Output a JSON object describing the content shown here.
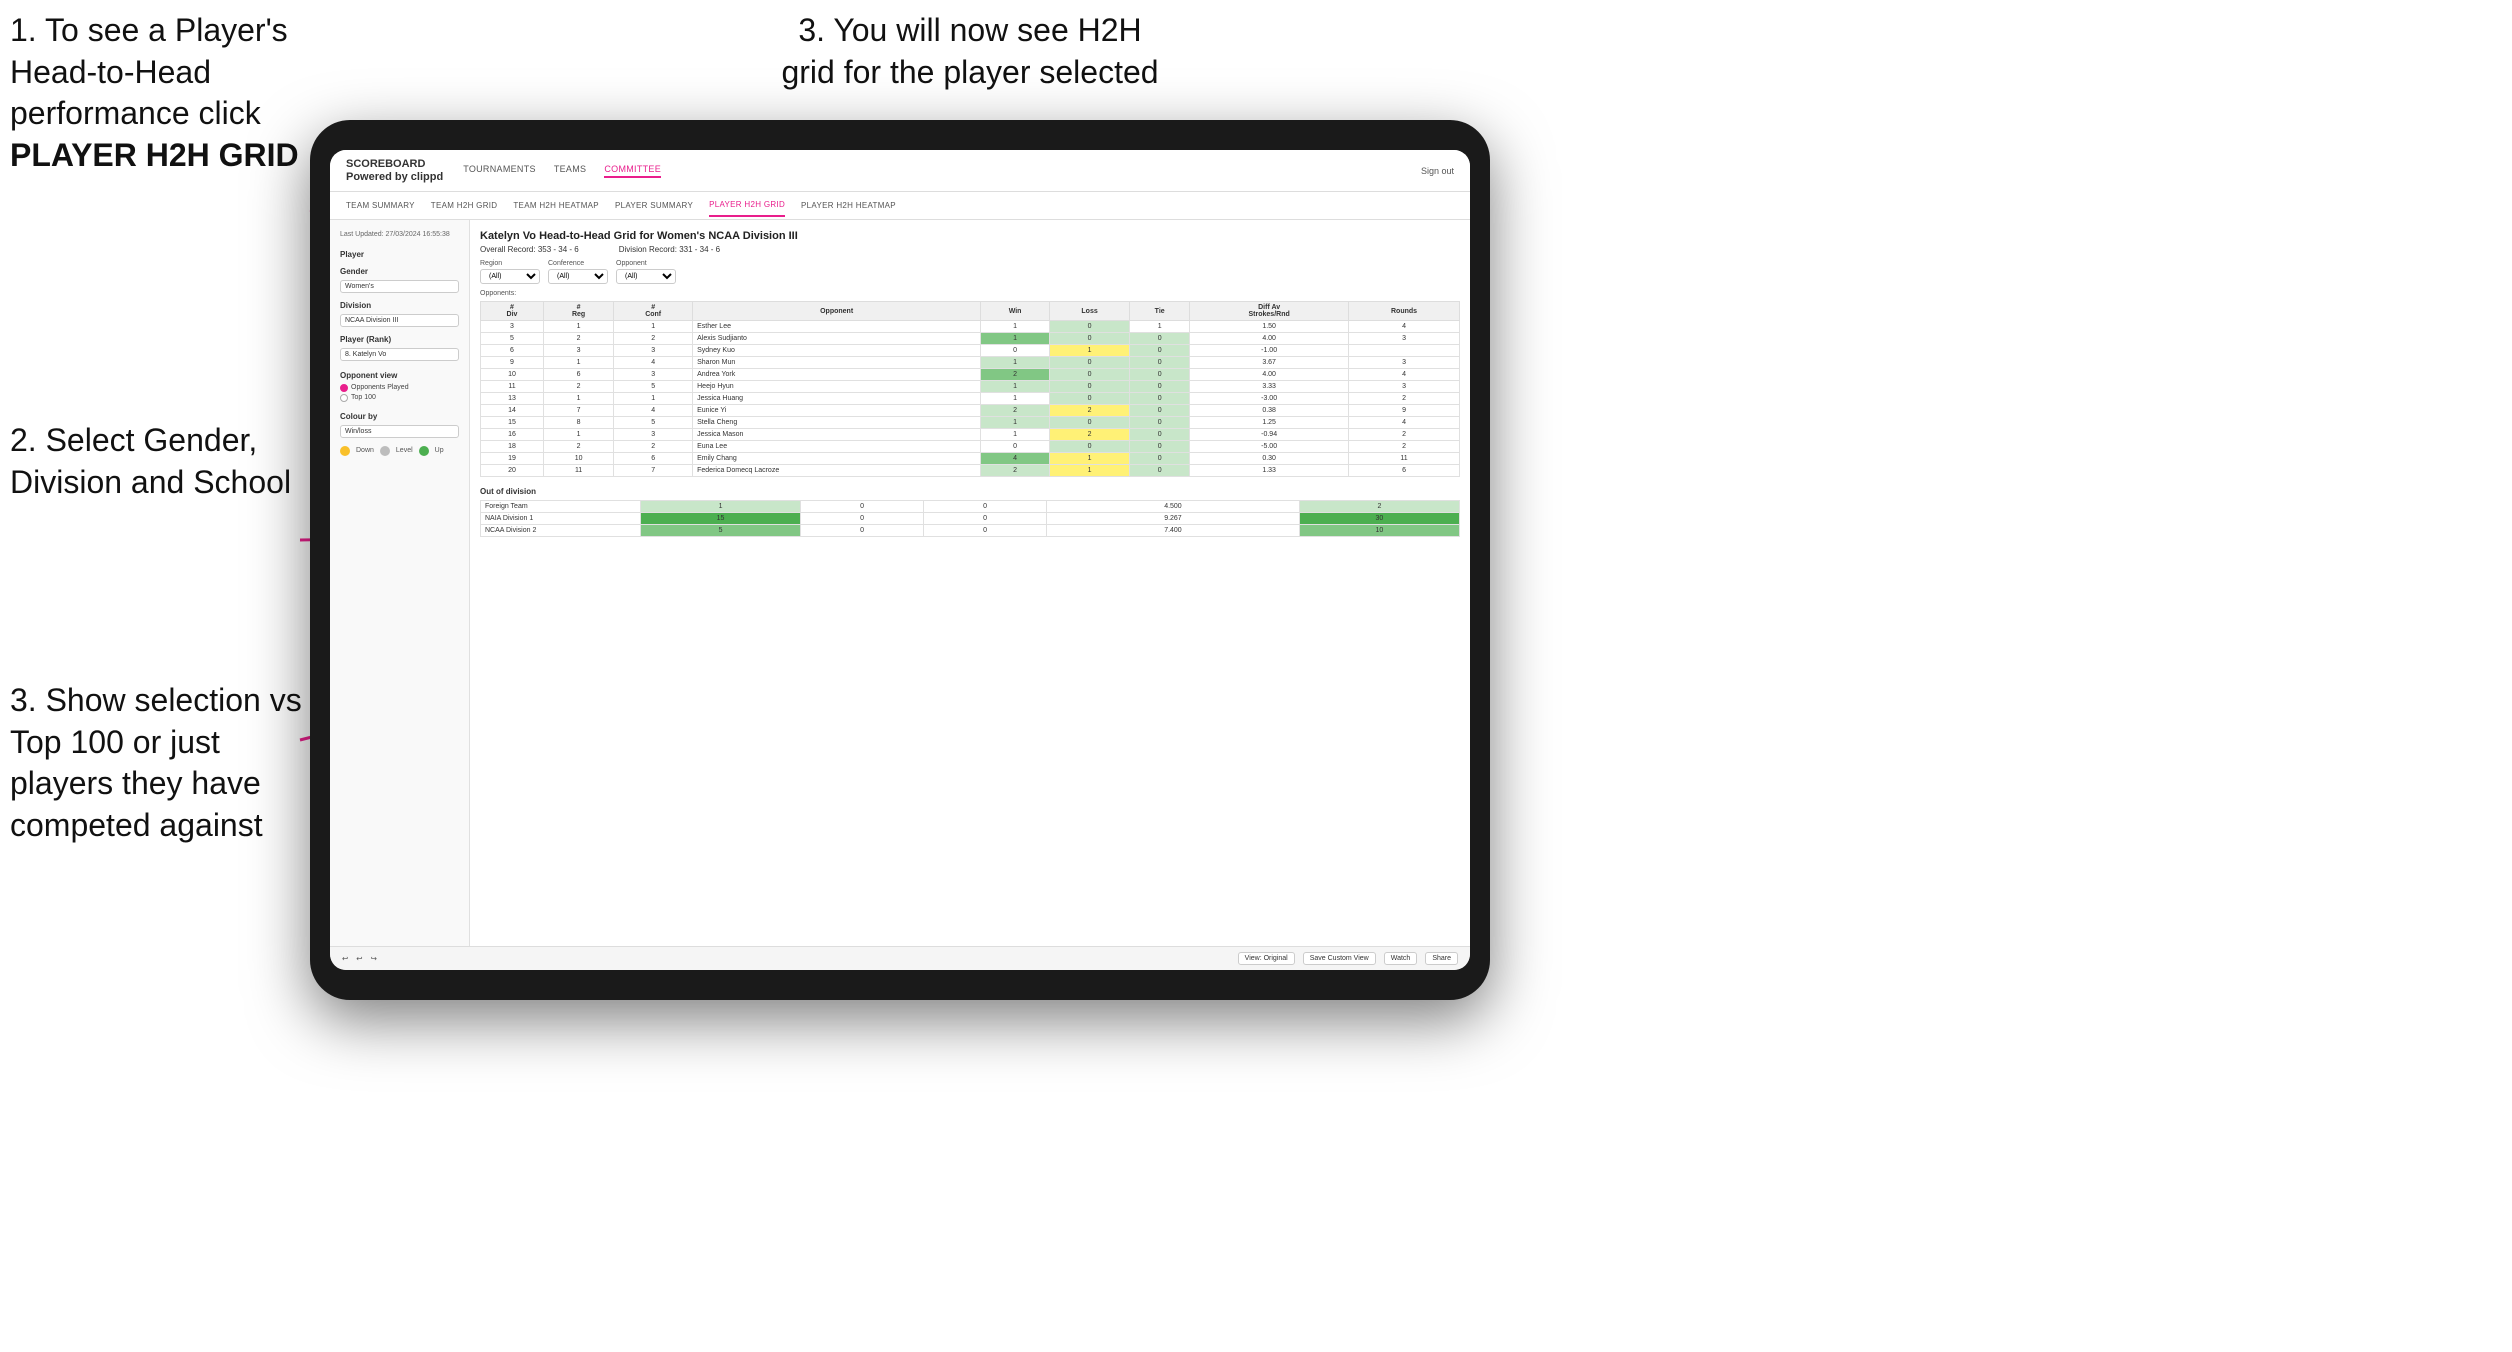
{
  "step1": {
    "text": "1. To see a Player's Head-to-Head performance click",
    "bold": "PLAYER H2H GRID"
  },
  "step2": {
    "text": "2. Select Gender, Division and School"
  },
  "step3_top": {
    "text": "3. You will now see H2H grid for the player selected"
  },
  "step3_bottom": {
    "text": "3. Show selection vs Top 100 or just players they have competed against"
  },
  "nav": {
    "logo": "SCOREBOARD",
    "logo_sub": "Powered by clippd",
    "items": [
      "TOURNAMENTS",
      "TEAMS",
      "COMMITTEE"
    ],
    "active": "COMMITTEE",
    "right": "Sign out"
  },
  "sub_nav": {
    "items": [
      "TEAM SUMMARY",
      "TEAM H2H GRID",
      "TEAM H2H HEATMAP",
      "PLAYER SUMMARY",
      "PLAYER H2H GRID",
      "PLAYER H2H HEATMAP"
    ],
    "active": "PLAYER H2H GRID"
  },
  "sidebar": {
    "last_updated": "Last Updated: 27/03/2024 16:55:38",
    "player_label": "Player",
    "gender_label": "Gender",
    "gender_value": "Women's",
    "division_label": "Division",
    "division_value": "NCAA Division III",
    "player_rank_label": "Player (Rank)",
    "player_rank_value": "8. Katelyn Vo",
    "opponent_view_label": "Opponent view",
    "opponent_options": [
      "Opponents Played",
      "Top 100"
    ],
    "opponent_selected": "Opponents Played",
    "colour_by_label": "Colour by",
    "colour_by_value": "Win/loss",
    "legend": [
      {
        "color": "#f9c02a",
        "label": "Down"
      },
      {
        "color": "#bdbdbd",
        "label": "Level"
      },
      {
        "color": "#4caf50",
        "label": "Up"
      }
    ]
  },
  "grid": {
    "title": "Katelyn Vo Head-to-Head Grid for Women's NCAA Division III",
    "overall_record_label": "Overall Record:",
    "overall_record": "353 - 34 - 6",
    "division_record_label": "Division Record:",
    "division_record": "331 - 34 - 6",
    "filters": {
      "region_label": "Region",
      "conference_label": "Conference",
      "opponent_label": "Opponent",
      "opponents_label": "Opponents:",
      "region_value": "(All)",
      "conference_value": "(All)",
      "opponent_value": "(All)"
    },
    "columns": [
      "#\nDiv",
      "#\nReg",
      "#\nConf",
      "Opponent",
      "Win",
      "Loss",
      "Tie",
      "Diff Av\nStrokes/Rnd",
      "Rounds"
    ],
    "rows": [
      {
        "div": "3",
        "reg": "1",
        "conf": "1",
        "opponent": "Esther Lee",
        "win": "1",
        "loss": "0",
        "tie": "1",
        "diff": "1.50",
        "rounds": "4",
        "win_bg": "bg-white",
        "loss_bg": "bg-green-light",
        "tie_bg": "bg-white"
      },
      {
        "div": "5",
        "reg": "2",
        "conf": "2",
        "opponent": "Alexis Sudjianto",
        "win": "1",
        "loss": "0",
        "tie": "0",
        "diff": "4.00",
        "rounds": "3",
        "win_bg": "bg-green-medium",
        "loss_bg": "bg-green-light",
        "tie_bg": "bg-green-light"
      },
      {
        "div": "6",
        "reg": "3",
        "conf": "3",
        "opponent": "Sydney Kuo",
        "win": "0",
        "loss": "1",
        "tie": "0",
        "diff": "-1.00",
        "rounds": "",
        "win_bg": "bg-white",
        "loss_bg": "bg-yellow-medium",
        "tie_bg": "bg-green-light"
      },
      {
        "div": "9",
        "reg": "1",
        "conf": "4",
        "opponent": "Sharon Mun",
        "win": "1",
        "loss": "0",
        "tie": "0",
        "diff": "3.67",
        "rounds": "3",
        "win_bg": "bg-green-light",
        "loss_bg": "bg-green-light",
        "tie_bg": "bg-green-light"
      },
      {
        "div": "10",
        "reg": "6",
        "conf": "3",
        "opponent": "Andrea York",
        "win": "2",
        "loss": "0",
        "tie": "0",
        "diff": "4.00",
        "rounds": "4",
        "win_bg": "bg-green-medium",
        "loss_bg": "bg-green-light",
        "tie_bg": "bg-green-light"
      },
      {
        "div": "11",
        "reg": "2",
        "conf": "5",
        "opponent": "Heejo Hyun",
        "win": "1",
        "loss": "0",
        "tie": "0",
        "diff": "3.33",
        "rounds": "3",
        "win_bg": "bg-green-light",
        "loss_bg": "bg-green-light",
        "tie_bg": "bg-green-light"
      },
      {
        "div": "13",
        "reg": "1",
        "conf": "1",
        "opponent": "Jessica Huang",
        "win": "1",
        "loss": "0",
        "tie": "0",
        "diff": "-3.00",
        "rounds": "2",
        "win_bg": "bg-white",
        "loss_bg": "bg-green-light",
        "tie_bg": "bg-green-light"
      },
      {
        "div": "14",
        "reg": "7",
        "conf": "4",
        "opponent": "Eunice Yi",
        "win": "2",
        "loss": "2",
        "tie": "0",
        "diff": "0.38",
        "rounds": "9",
        "win_bg": "bg-green-light",
        "loss_bg": "bg-yellow-medium",
        "tie_bg": "bg-green-light"
      },
      {
        "div": "15",
        "reg": "8",
        "conf": "5",
        "opponent": "Stella Cheng",
        "win": "1",
        "loss": "0",
        "tie": "0",
        "diff": "1.25",
        "rounds": "4",
        "win_bg": "bg-green-light",
        "loss_bg": "bg-green-light",
        "tie_bg": "bg-green-light"
      },
      {
        "div": "16",
        "reg": "1",
        "conf": "3",
        "opponent": "Jessica Mason",
        "win": "1",
        "loss": "2",
        "tie": "0",
        "diff": "-0.94",
        "rounds": "2",
        "win_bg": "bg-white",
        "loss_bg": "bg-yellow-medium",
        "tie_bg": "bg-green-light"
      },
      {
        "div": "18",
        "reg": "2",
        "conf": "2",
        "opponent": "Euna Lee",
        "win": "0",
        "loss": "0",
        "tie": "0",
        "diff": "-5.00",
        "rounds": "2",
        "win_bg": "bg-white",
        "loss_bg": "bg-green-light",
        "tie_bg": "bg-green-light"
      },
      {
        "div": "19",
        "reg": "10",
        "conf": "6",
        "opponent": "Emily Chang",
        "win": "4",
        "loss": "1",
        "tie": "0",
        "diff": "0.30",
        "rounds": "11",
        "win_bg": "bg-green-medium",
        "loss_bg": "bg-yellow-medium",
        "tie_bg": "bg-green-light"
      },
      {
        "div": "20",
        "reg": "11",
        "conf": "7",
        "opponent": "Federica Domecq Lacroze",
        "win": "2",
        "loss": "1",
        "tie": "0",
        "diff": "1.33",
        "rounds": "6",
        "win_bg": "bg-green-light",
        "loss_bg": "bg-yellow-medium",
        "tie_bg": "bg-green-light"
      }
    ],
    "out_of_division_label": "Out of division",
    "out_of_division_rows": [
      {
        "name": "Foreign Team",
        "win": "1",
        "loss": "0",
        "tie": "0",
        "diff": "4.500",
        "rounds": "2",
        "win_bg": "bg-green-light"
      },
      {
        "name": "NAIA Division 1",
        "win": "15",
        "loss": "0",
        "tie": "0",
        "diff": "9.267",
        "rounds": "30",
        "win_bg": "bg-green-dark"
      },
      {
        "name": "NCAA Division 2",
        "win": "5",
        "loss": "0",
        "tie": "0",
        "diff": "7.400",
        "rounds": "10",
        "win_bg": "bg-green-medium"
      }
    ]
  },
  "toolbar": {
    "view_original": "View: Original",
    "save_custom": "Save Custom View",
    "watch": "Watch",
    "share": "Share"
  }
}
